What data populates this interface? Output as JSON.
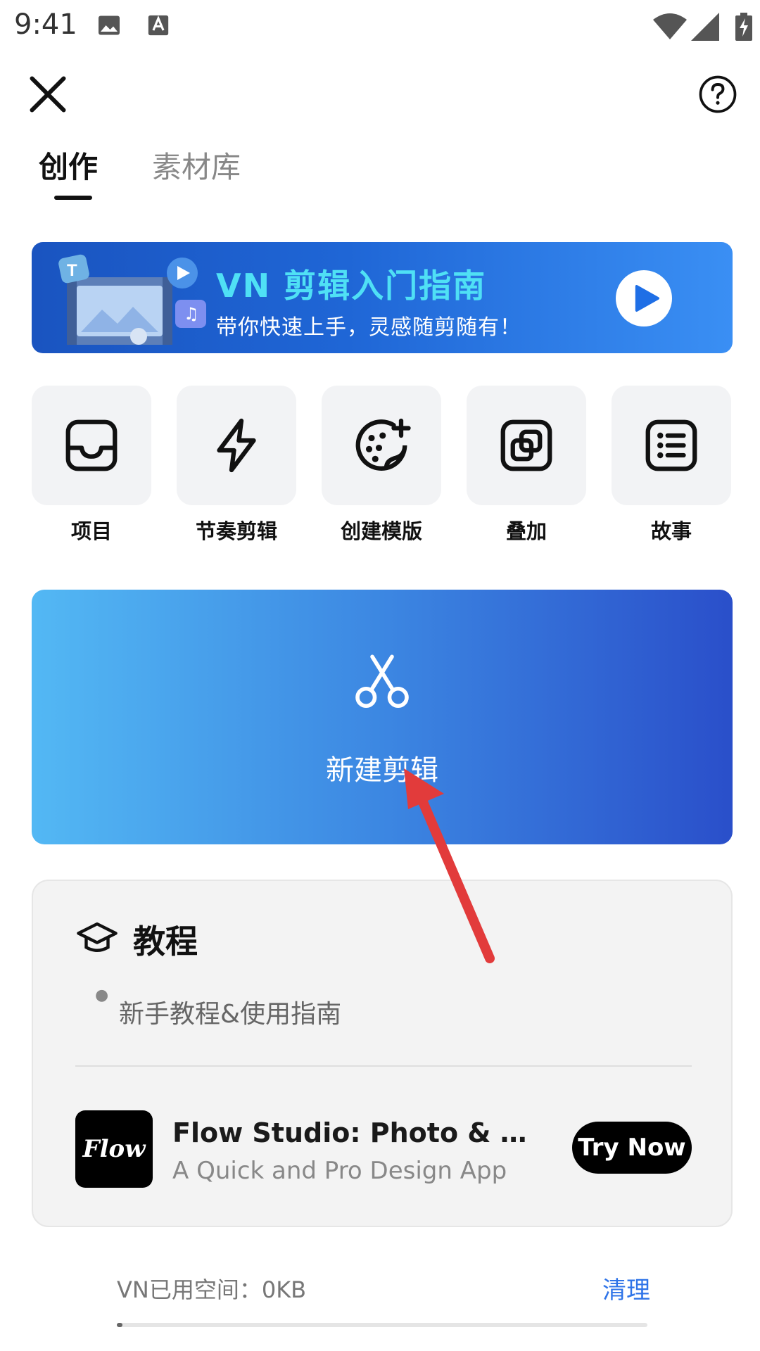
{
  "status_bar": {
    "time": "9:41"
  },
  "tabs": [
    {
      "label": "创作",
      "active": true
    },
    {
      "label": "素材库",
      "active": false
    }
  ],
  "banner": {
    "title": "VN 剪辑入门指南",
    "subtitle": "带你快速上手，灵感随剪随有！"
  },
  "tools": [
    {
      "label": "项目",
      "icon": "inbox-icon"
    },
    {
      "label": "节奏剪辑",
      "icon": "lightning-icon"
    },
    {
      "label": "创建模版",
      "icon": "palette-plus-icon"
    },
    {
      "label": "叠加",
      "icon": "overlay-icon"
    },
    {
      "label": "故事",
      "icon": "list-icon"
    }
  ],
  "new_edit": {
    "label": "新建剪辑",
    "icon": "scissors-icon"
  },
  "tutorial": {
    "title": "教程",
    "items": [
      "新手教程&使用指南"
    ]
  },
  "ad": {
    "logo_text": "Flow",
    "title": "Flow Studio: Photo & Grap…",
    "subtitle": "A Quick and Pro Design App",
    "button": "Try Now"
  },
  "storage": {
    "label": "VN已用空间：0KB",
    "clean": "清理",
    "used_fraction": 0.01
  },
  "colors": {
    "banner_title": "#4fe0f5",
    "accent_blue": "#2f74e8",
    "annotation_red": "#e23b3b"
  }
}
